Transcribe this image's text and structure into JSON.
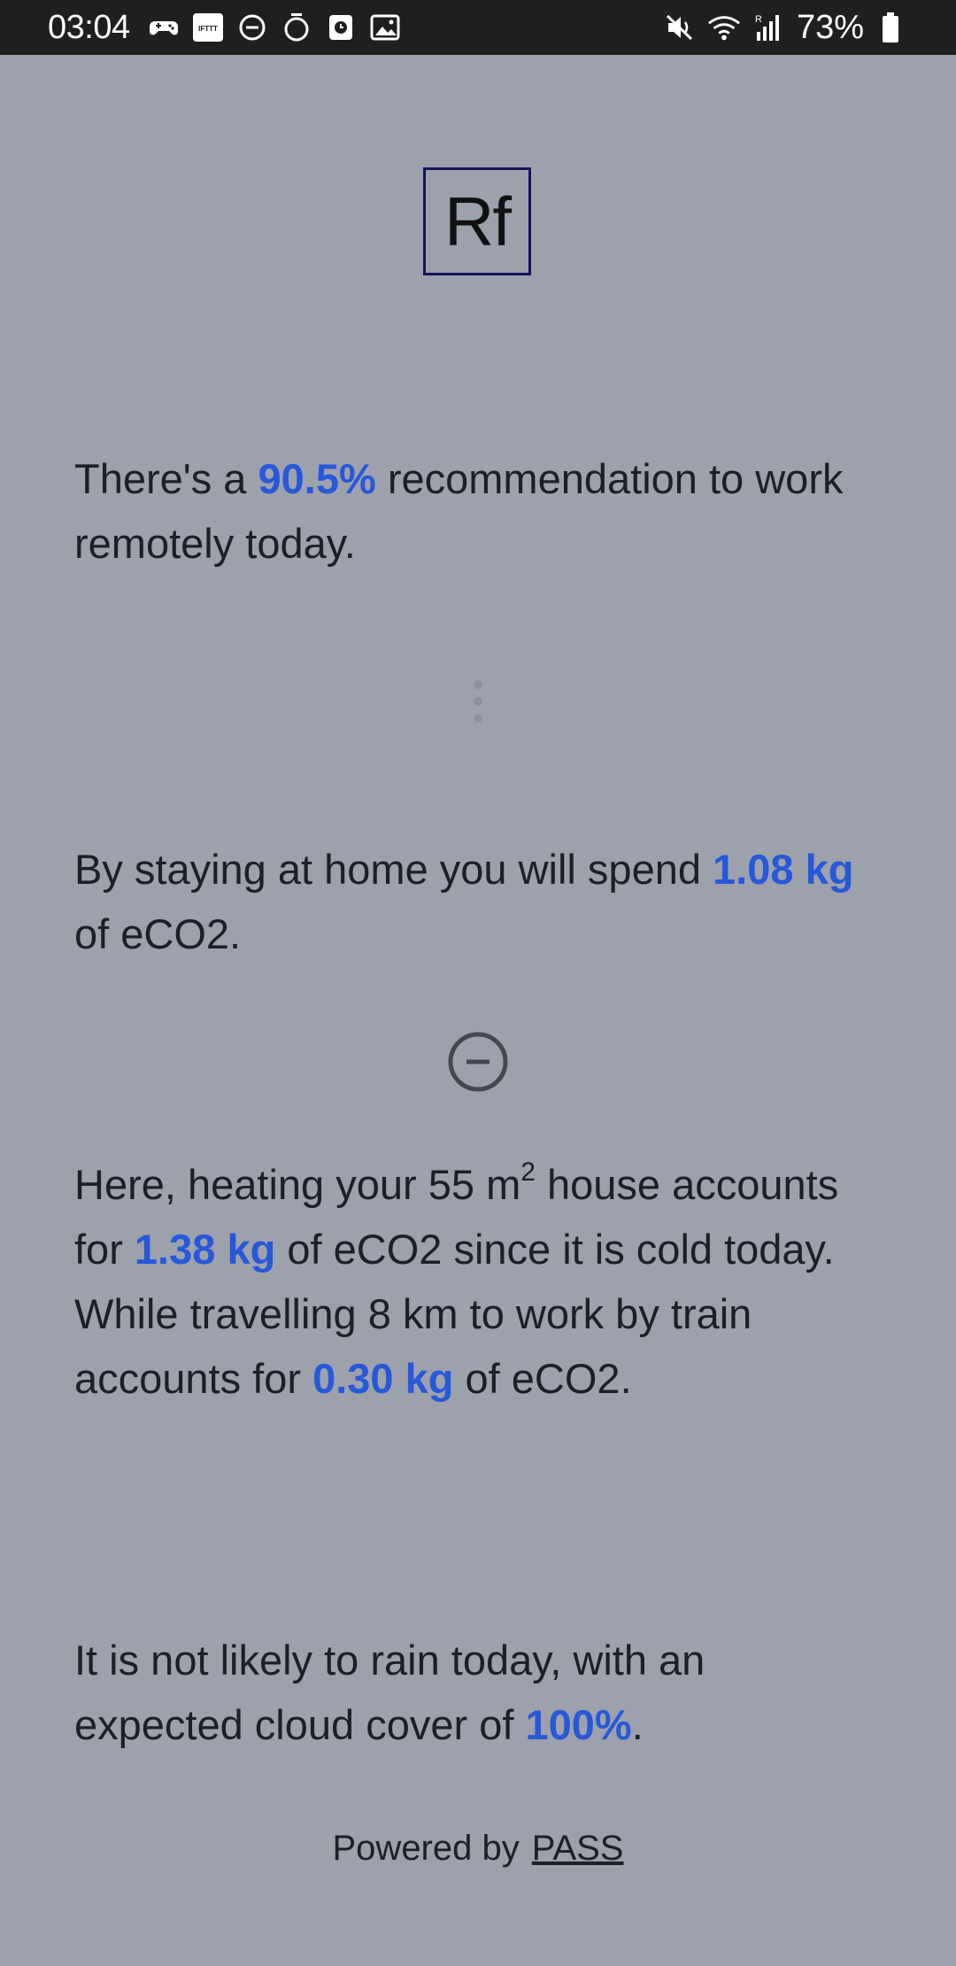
{
  "status_bar": {
    "time": "03:04",
    "left_icons": [
      "game-controller-icon",
      "ifttt-icon",
      "do-not-disturb-icon",
      "timer-icon",
      "clock-app-icon",
      "gallery-icon"
    ],
    "right_icons": [
      "mute-icon",
      "wifi-icon",
      "signal-icon",
      "battery-icon"
    ],
    "battery_percent": "73%"
  },
  "logo": {
    "text": "Rf"
  },
  "recommendation": {
    "prefix": "There's a ",
    "percent": "90.5%",
    "suffix": " recommendation to work remotely today."
  },
  "home_spend": {
    "prefix": "By staying at home you will spend ",
    "amount": "1.08 kg",
    "suffix": " of eCO2."
  },
  "details": {
    "part1": "Here, heating your 55 m",
    "sup": "2",
    "part2": " house accounts for ",
    "heating_amount": "1.38 kg",
    "part3": " of eCO2 since it is cold today. While travelling 8 km to work by train accounts for ",
    "train_amount": "0.30 kg",
    "part4": " of eCO2."
  },
  "weather": {
    "prefix": "It is not likely to rain today, with an expected cloud cover of ",
    "cloud_cover": "100%",
    "suffix": "."
  },
  "footer": {
    "powered_by": "Powered by",
    "link": "PASS"
  },
  "colors": {
    "background": "#9ca1ac",
    "highlight": "#2658d8",
    "status_bar": "#1f1f1f"
  }
}
